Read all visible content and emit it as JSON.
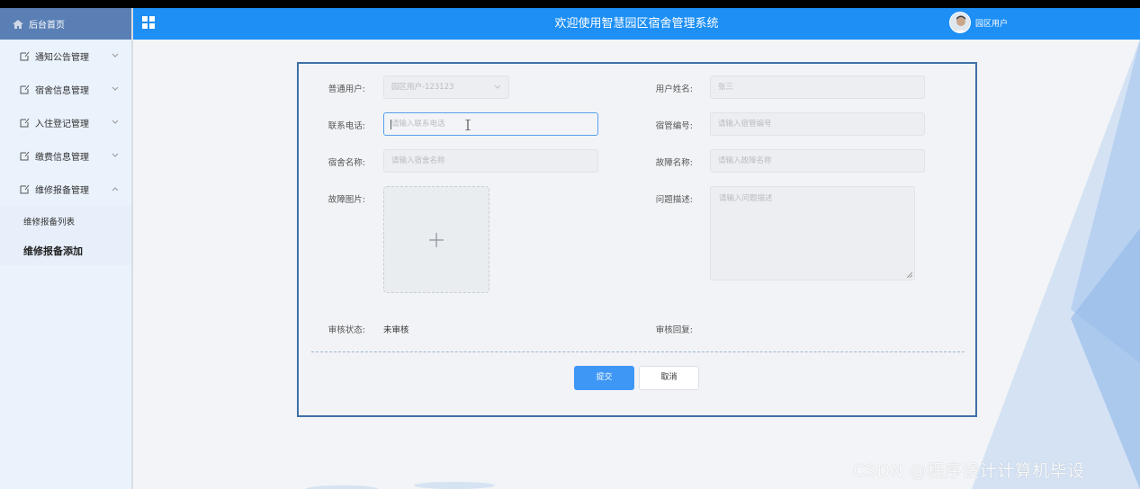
{
  "sidebar": {
    "brand_label": "后台首页",
    "items": [
      {
        "label": "通知公告管理"
      },
      {
        "label": "宿舍信息管理"
      },
      {
        "label": "入住登记管理"
      },
      {
        "label": "缴费信息管理"
      },
      {
        "label": "维修报备管理"
      }
    ],
    "submenu": [
      {
        "label": "维修报备列表"
      },
      {
        "label": "维修报备添加"
      }
    ]
  },
  "header": {
    "title": "欢迎使用智慧园区宿舍管理系统",
    "user_name": "园区用户"
  },
  "form": {
    "user_label": "普通用户:",
    "user_value": "园区用户-123123",
    "name_label": "用户姓名:",
    "name_value": "张三",
    "phone_label": "联系电话:",
    "phone_placeholder": "请输入联系电话",
    "manager_no_label": "宿管编号:",
    "manager_no_placeholder": "请输入宿管编号",
    "dorm_label": "宿舍名称:",
    "dorm_placeholder": "请输入宿舍名称",
    "fault_label": "故障名称:",
    "fault_placeholder": "请输入故障名称",
    "image_label": "故障图片:",
    "desc_label": "问题描述:",
    "desc_placeholder": "请输入问题描述",
    "status_label": "审核状态:",
    "status_value": "未审核",
    "reply_label": "审核回复:",
    "submit_label": "提交",
    "cancel_label": "取消"
  },
  "watermark": "CSDN @程序设计计算机毕设",
  "colors": {
    "header_bg": "#1d8ff5",
    "primary_button": "#3e97f5",
    "card_border": "#3e6fa6"
  }
}
